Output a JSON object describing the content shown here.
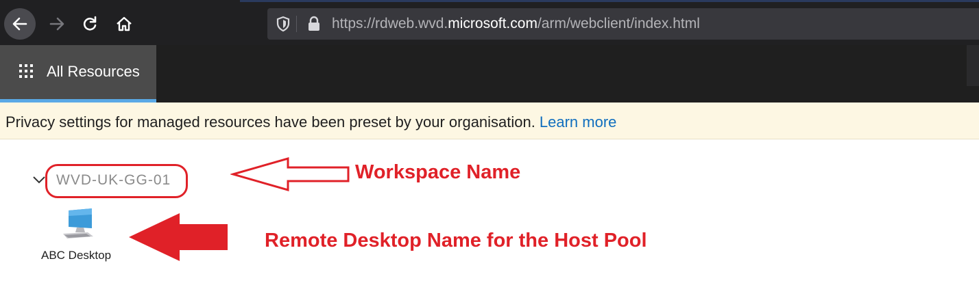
{
  "browser": {
    "url_prefix": "https://rdweb.wvd.",
    "url_domain": "microsoft.com",
    "url_path": "/arm/webclient/index.html"
  },
  "app": {
    "tab_label": "All Resources"
  },
  "privacy": {
    "message": "Privacy settings for managed resources have been preset by your organisation.",
    "link": "Learn more"
  },
  "workspace": {
    "name": "WVD-UK-GG-01"
  },
  "resource": {
    "label": "ABC Desktop"
  },
  "annotations": {
    "workspace": "Workspace Name",
    "desktop": "Remote Desktop Name for the Host Pool"
  },
  "colors": {
    "annotation_red": "#e02128",
    "link_blue": "#106ebe",
    "tab_underline": "#5aa9e6"
  }
}
